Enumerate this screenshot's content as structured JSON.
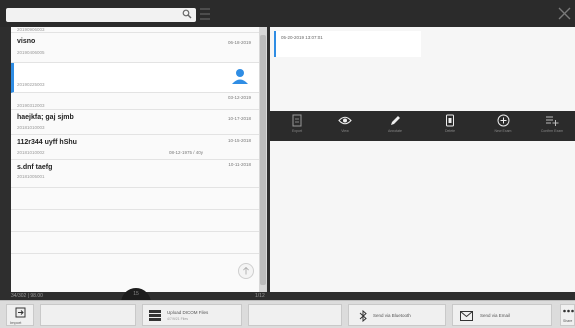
{
  "header": {
    "search_placeholder": ""
  },
  "list": {
    "top_id": "20190906003",
    "rows": [
      {
        "name": "visno",
        "id": "20190406005",
        "date": "06-18-2019"
      },
      {
        "name": "",
        "id": "20190225003",
        "date": ""
      },
      {
        "name": "",
        "id": "20190312003",
        "date": "03-12-2019"
      },
      {
        "name": "haejkfa; gaj sjmb",
        "id": "20181010003",
        "date": "10-17-2018"
      },
      {
        "name": "112r344 uyff hShu",
        "id": "20181010002",
        "date": "10-15-2018",
        "mid": "08-12-1975 / 40y"
      },
      {
        "name": "s.dnf taefg",
        "id": "20181005001",
        "date": "10-11-2018"
      }
    ]
  },
  "status": {
    "left": "34/302 | 98.00",
    "right": "1/12",
    "badge": "15"
  },
  "detail": {
    "note_date": "05-20-2019 13:07:01"
  },
  "toolbar": {
    "items": [
      {
        "label": "Export",
        "icon": "document-icon"
      },
      {
        "label": "View",
        "icon": "eye-icon"
      },
      {
        "label": "Annotate",
        "icon": "pencil-icon"
      },
      {
        "label": "Delete",
        "icon": "trash-icon"
      },
      {
        "label": "New Exam",
        "icon": "plus-circle-icon"
      },
      {
        "label": "Confirm Exam",
        "icon": "list-add-icon"
      }
    ]
  },
  "bottom": {
    "import_label": "Import",
    "upload_label": "Upload DICOM Files",
    "upload_sub": "4/7/9/21 Files",
    "bluetooth_label": "Send via Bluetooth",
    "email_label": "Send via Email",
    "more_label": "Share"
  },
  "colors": {
    "accent": "#2f8de4",
    "dark": "#2b2b2b"
  }
}
